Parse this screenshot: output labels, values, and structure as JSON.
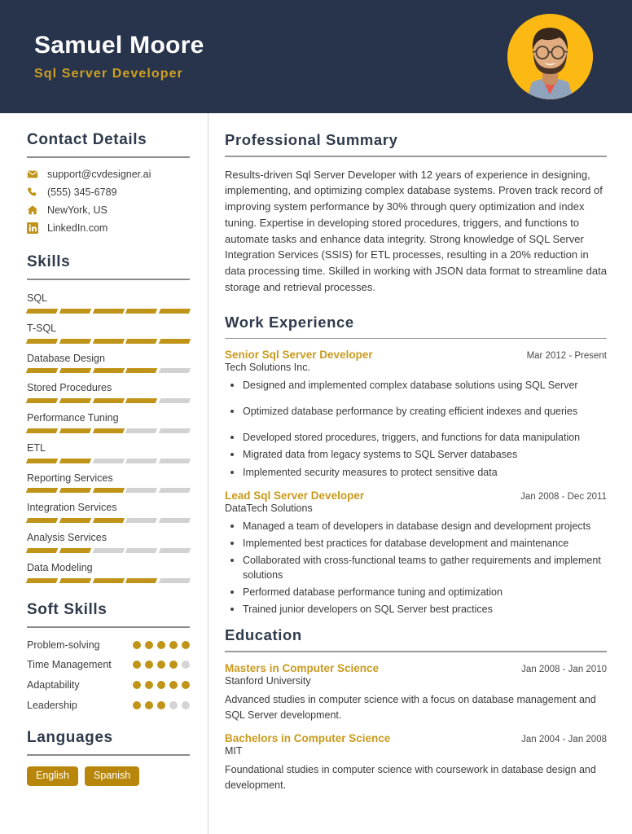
{
  "header": {
    "name": "Samuel Moore",
    "job_title": "Sql Server Developer",
    "avatar_bg": "#FDB913",
    "bg_color": "#27344C",
    "accent_color": "#C99A1E"
  },
  "sidebar": {
    "contact": {
      "title": "Contact Details",
      "items": [
        {
          "icon": "envelope-icon",
          "value": "support@cvdesigner.ai"
        },
        {
          "icon": "phone-icon",
          "value": "(555) 345-6789"
        },
        {
          "icon": "home-icon",
          "value": "NewYork, US"
        },
        {
          "icon": "linkedin-icon",
          "value": "LinkedIn.com"
        }
      ]
    },
    "skills": {
      "title": "Skills",
      "max_level": 5,
      "items": [
        {
          "name": "SQL",
          "level": 5
        },
        {
          "name": "T-SQL",
          "level": 5
        },
        {
          "name": "Database Design",
          "level": 4
        },
        {
          "name": "Stored Procedures",
          "level": 4
        },
        {
          "name": "Performance Tuning",
          "level": 3
        },
        {
          "name": "ETL",
          "level": 2
        },
        {
          "name": "Reporting Services",
          "level": 3
        },
        {
          "name": "Integration Services",
          "level": 3
        },
        {
          "name": "Analysis Services",
          "level": 2
        },
        {
          "name": "Data Modeling",
          "level": 4
        }
      ]
    },
    "soft_skills": {
      "title": "Soft Skills",
      "max_level": 5,
      "items": [
        {
          "name": "Problem-solving",
          "level": 5
        },
        {
          "name": "Time Management",
          "level": 4
        },
        {
          "name": "Adaptability",
          "level": 5
        },
        {
          "name": "Leadership",
          "level": 3
        }
      ]
    },
    "languages": {
      "title": "Languages",
      "items": [
        "English",
        "Spanish"
      ]
    }
  },
  "main": {
    "summary": {
      "title": "Professional Summary",
      "text": "Results-driven Sql Server Developer with 12 years of experience in designing, implementing, and optimizing complex database systems. Proven track record of improving system performance by 30% through query optimization and index tuning. Expertise in developing stored procedures, triggers, and functions to automate tasks and enhance data integrity. Strong knowledge of SQL Server Integration Services (SSIS) for ETL processes, resulting in a 20% reduction in data processing time. Skilled in working with JSON data format to streamline data storage and retrieval processes."
    },
    "work_experience": {
      "title": "Work Experience",
      "entries": [
        {
          "role": "Senior Sql Server Developer",
          "dates": "Mar 2012 - Present",
          "organization": "Tech Solutions Inc.",
          "bullets": [
            "Designed and implemented complex database solutions using SQL Server",
            "Optimized database performance by creating efficient indexes and queries",
            "Developed stored procedures, triggers, and functions for data manipulation",
            "Migrated data from legacy systems to SQL Server databases",
            "Implemented security measures to protect sensitive data"
          ]
        },
        {
          "role": "Lead Sql Server Developer",
          "dates": "Jan 2008 - Dec 2011",
          "organization": "DataTech Solutions",
          "bullets": [
            "Managed a team of developers in database design and development projects",
            "Implemented best practices for database development and maintenance",
            "Collaborated with cross-functional teams to gather requirements and implement solutions",
            "Performed database performance tuning and optimization",
            "Trained junior developers on SQL Server best practices"
          ]
        }
      ]
    },
    "education": {
      "title": "Education",
      "entries": [
        {
          "degree": "Masters in Computer Science",
          "dates": "Jan 2008 - Jan 2010",
          "school": "Stanford University",
          "description": "Advanced studies in computer science with a focus on database management and SQL Server development."
        },
        {
          "degree": "Bachelors in Computer Science",
          "dates": "Jan 2004 - Jan 2008",
          "school": "MIT",
          "description": "Foundational studies in computer science with coursework in database design and development."
        }
      ]
    }
  }
}
